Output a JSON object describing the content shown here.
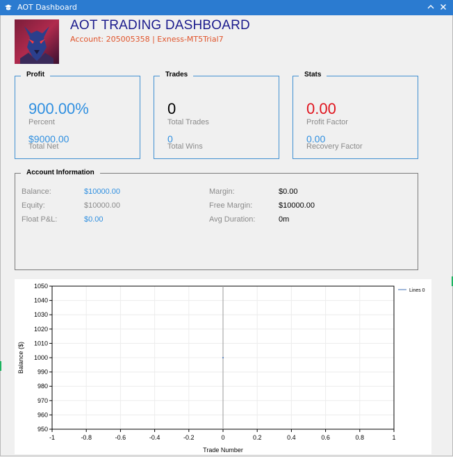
{
  "window": {
    "title": "AOT Dashboard"
  },
  "header": {
    "title": "AOT TRADING DASHBOARD",
    "account": "Account: 205005358 | Exness-MT5Trial7"
  },
  "profit": {
    "caption": "Profit",
    "percent_value": "900.00%",
    "percent_label": "Percent",
    "net_value": "$9000.00",
    "net_label": "Total Net"
  },
  "trades": {
    "caption": "Trades",
    "total_value": "0",
    "total_label": "Total Trades",
    "wins_value": "0",
    "wins_label": "Total Wins"
  },
  "stats": {
    "caption": "Stats",
    "pf_value": "0.00",
    "pf_label": "Profit Factor",
    "rf_value": "0.00",
    "rf_label": "Recovery Factor"
  },
  "account_info": {
    "caption": "Account Information",
    "left": [
      {
        "label": "Balance:",
        "value": "$10000.00",
        "color": "#2f8fe0"
      },
      {
        "label": "Equity:",
        "value": "$10000.00",
        "color": "#8a8a8a"
      },
      {
        "label": "Float P&L:",
        "value": "$0.00",
        "color": "#2f8fe0"
      }
    ],
    "right": [
      {
        "label": "Margin:",
        "value": "$0.00"
      },
      {
        "label": "Free Margin:",
        "value": "$10000.00"
      },
      {
        "label": "Avg Duration:",
        "value": "0m"
      }
    ]
  },
  "colors": {
    "accent": "#2b7bd0",
    "profit": "#2f8fe0",
    "loss": "#e0141e",
    "title": "#1a1a8c",
    "account": "#e0532a"
  },
  "chart_data": {
    "type": "line",
    "xlabel": "Trade Number",
    "ylabel": "Balance ($)",
    "xlim": [
      -1,
      1
    ],
    "ylim": [
      950,
      1050
    ],
    "x_ticks": [
      "-1",
      "-0.8",
      "-0.6",
      "-0.4",
      "-0.2",
      "0",
      "0.2",
      "0.4",
      "0.6",
      "0.8",
      "1"
    ],
    "y_ticks": [
      "1050",
      "1040",
      "1030",
      "1020",
      "1010",
      "1000",
      "990",
      "980",
      "970",
      "960",
      "950"
    ],
    "grid": true,
    "legend_position": "top-right",
    "series": [
      {
        "name": "Lines 0",
        "x": [
          0
        ],
        "y": [
          1000
        ],
        "color": "#3f6fb5"
      }
    ]
  }
}
